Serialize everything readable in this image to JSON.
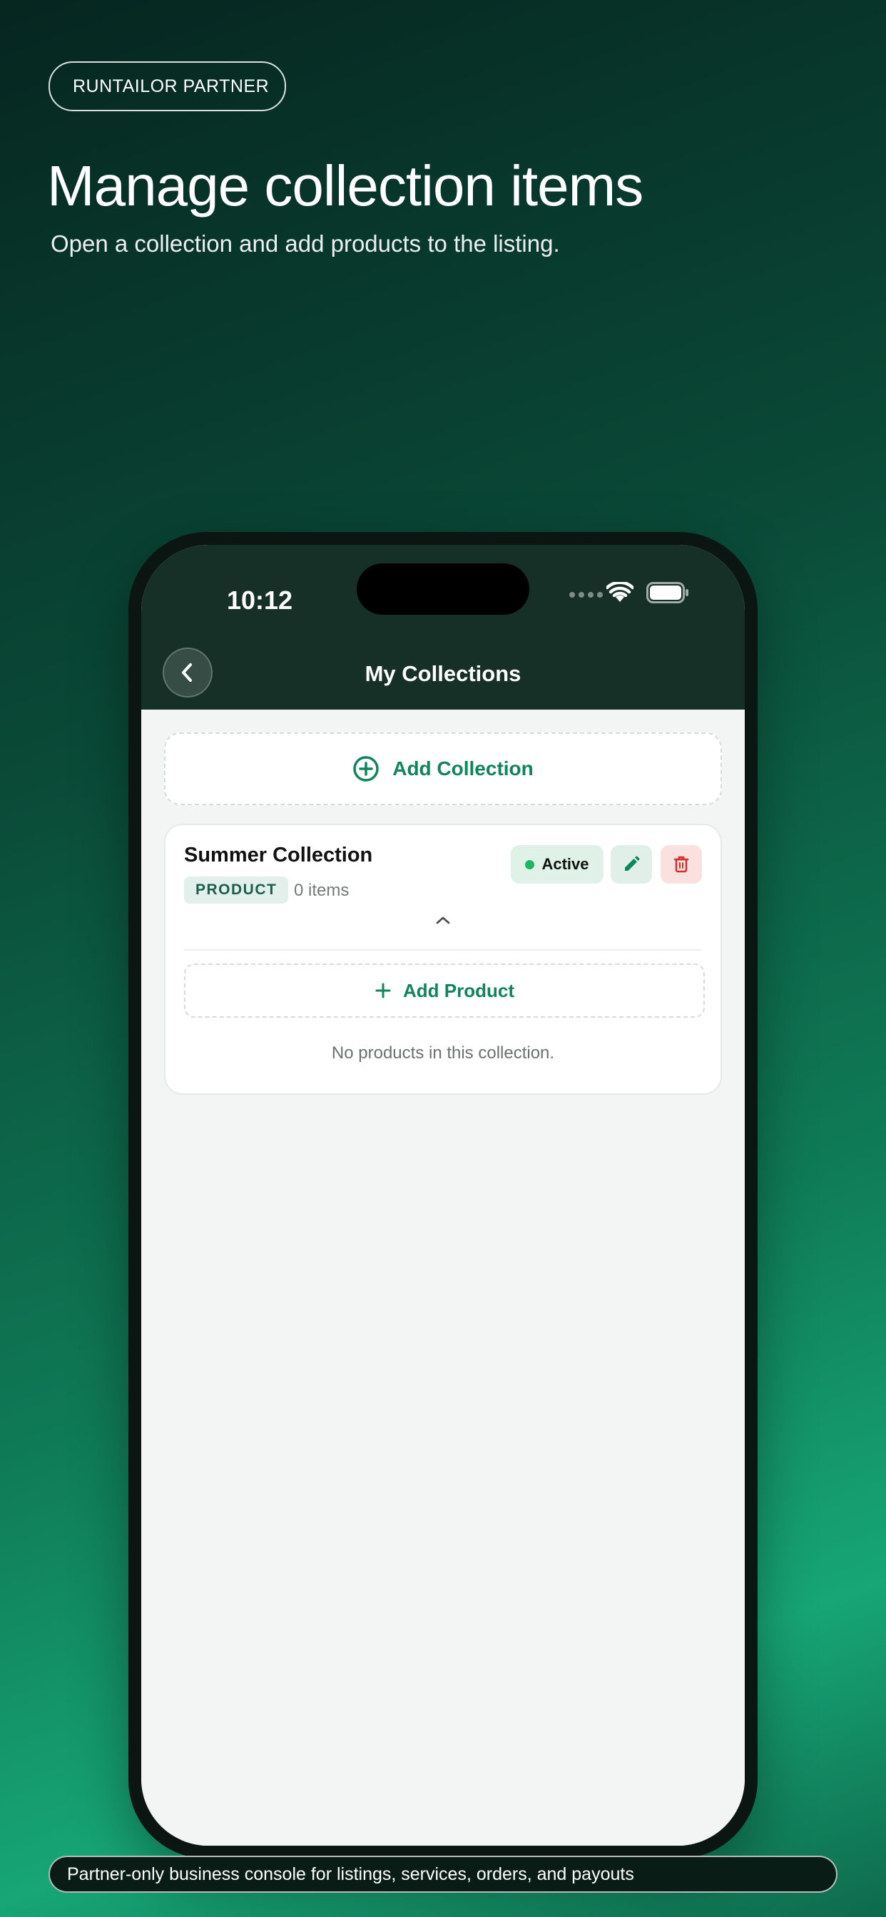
{
  "brand": {
    "label": "RUNTAILOR PARTNER"
  },
  "hero": {
    "title": "Manage collection items",
    "subtitle": "Open a collection and add products to the listing."
  },
  "status_bar": {
    "time": "10:12"
  },
  "nav": {
    "title": "My Collections",
    "back_icon": "chevron-left-icon"
  },
  "add_collection": {
    "label": "Add Collection",
    "icon": "plus-circle-icon"
  },
  "collections": [
    {
      "name": "Summer Collection",
      "type": "PRODUCT",
      "item_count": "0 items",
      "status": "Active",
      "expanded": true,
      "add_product_label": "Add Product",
      "empty_text": "No products in this collection."
    }
  ],
  "footer": {
    "text": "Partner-only business console for listings, services, orders, and payouts"
  },
  "colors": {
    "accent": "#10845a",
    "nav_bg": "#163027",
    "status_active": "#1fb563",
    "delete": "#d0312d"
  }
}
